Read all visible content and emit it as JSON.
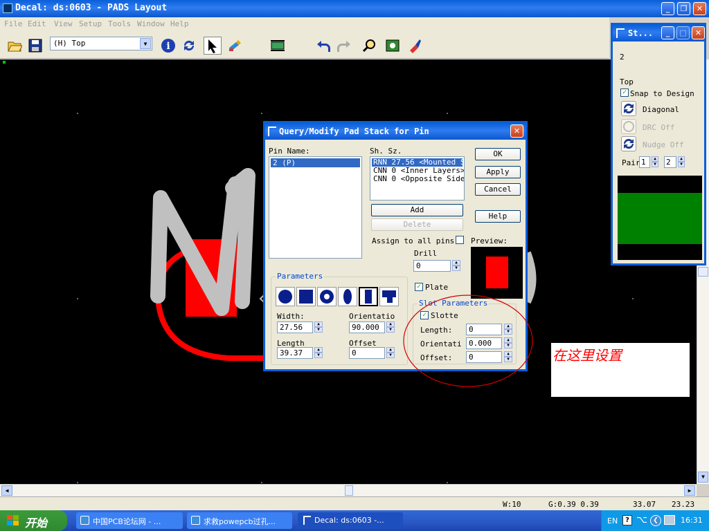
{
  "window": {
    "title": "Decal: ds:0603 - PADS Layout"
  },
  "menu": [
    "File",
    "Edit",
    "View",
    "Setup",
    "Tools",
    "Window",
    "Help"
  ],
  "toolbar": {
    "layer_value": "(H) Top"
  },
  "dialog": {
    "title": "Query/Modify Pad Stack for Pin",
    "pin_name_label": "Pin Name:",
    "pin_items": [
      "2 (P)"
    ],
    "sh_sz_label": "Sh. Sz.",
    "shape_items": [
      "RNN 27.56 <Mounted Side>",
      "CNN 0 <Inner Layers>",
      "CNN 0 <Opposite Side>"
    ],
    "ok": "OK",
    "apply": "Apply",
    "cancel": "Cancel",
    "help": "Help",
    "add": "Add",
    "delete": "Delete",
    "assign_label": "Assign to all pins",
    "preview_label": "Preview:",
    "drill_label": "Drill",
    "drill_value": "0",
    "plated_label": "Plate",
    "parameters_label": "Parameters",
    "width_label": "Width:",
    "width_value": "27.56",
    "orientation_label": "Orientatio",
    "orientation_value": "90.000",
    "length_label": "Length",
    "length_value": "39.37",
    "offset_label": "Offset",
    "offset_value": "0",
    "slot_label": "Slot Parameters",
    "slotted_label": "Slotte",
    "slot_length_label": "Length:",
    "slot_length_value": "0",
    "slot_orient_label": "Orientati",
    "slot_orient_value": "0.000",
    "slot_offset_label": "Offset:",
    "slot_offset_value": "0"
  },
  "panel": {
    "title": "St...",
    "value": "2",
    "layer": "Top",
    "snap_label": "Snap to Design G",
    "diagonal": "Diagonal",
    "drc": "DRC Off",
    "nudge": "Nudge Off",
    "pair_label": "Pair",
    "pair1": "1",
    "pair2": "2"
  },
  "annotation": "在这里设置",
  "status": {
    "w": "W:10",
    "g": "G:0.39 0.39",
    "x": "33.07",
    "y": "23.23"
  },
  "taskbar": {
    "start": "开始",
    "tasks": [
      "中国PCB论坛网 - ...",
      "求救powepcb过孔...",
      "Decal: ds:0603 -..."
    ],
    "lang": "EN",
    "time": "16:31"
  },
  "colors": {
    "titlebar": "#0a5fd8",
    "canvas": "#000000",
    "pad": "#ff0000",
    "silk": "#c0c0c0",
    "preview_green": "#008000"
  }
}
